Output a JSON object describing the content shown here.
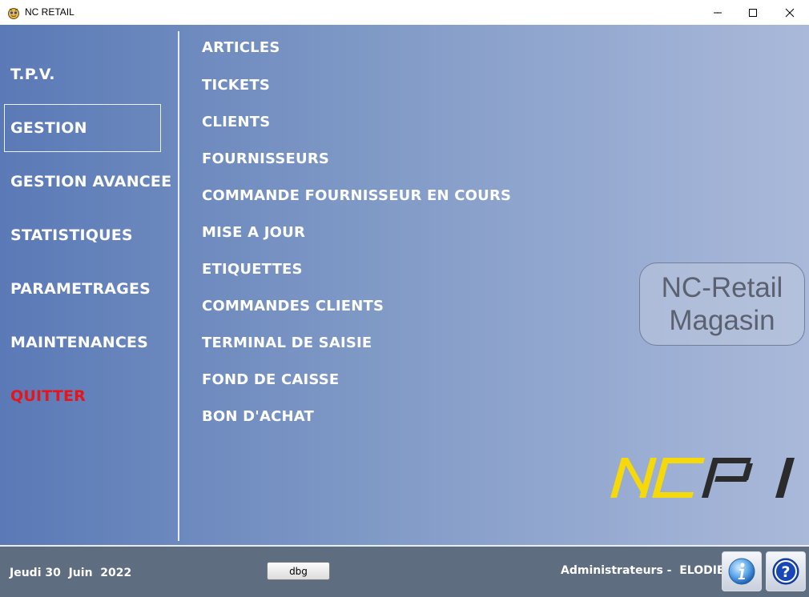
{
  "window": {
    "title": "NC RETAIL"
  },
  "sidebar": {
    "items": [
      {
        "label": "T.P.V."
      },
      {
        "label": "GESTION"
      },
      {
        "label": "GESTION AVANCEE"
      },
      {
        "label": "STATISTIQUES"
      },
      {
        "label": "PARAMETRAGES"
      },
      {
        "label": "MAINTENANCES"
      },
      {
        "label": "QUITTER"
      }
    ],
    "selected": "GESTION",
    "quit_color": "#e8141a"
  },
  "menu": {
    "items": [
      {
        "label": "ARTICLES"
      },
      {
        "label": "TICKETS"
      },
      {
        "label": "CLIENTS"
      },
      {
        "label": "FOURNISSEURS"
      },
      {
        "label": "COMMANDE FOURNISSEUR EN COURS"
      },
      {
        "label": "MISE A JOUR"
      },
      {
        "label": "ETIQUETTES"
      },
      {
        "label": "COMMANDES CLIENTS"
      },
      {
        "label": "TERMINAL DE SAISIE"
      },
      {
        "label": "FOND DE CAISSE"
      },
      {
        "label": "BON D'ACHAT"
      }
    ]
  },
  "brand": {
    "line1": "NC-Retail",
    "line2": "Magasin",
    "logo_text": "NCPI",
    "logo_colors": {
      "yellow": "#f5d90a",
      "dark": "#2b2b2b"
    }
  },
  "footer": {
    "date": "Jeudi 30  Juin  2022",
    "dbg_label": "dbg",
    "user": "Administrateurs -  ELODIE"
  },
  "icons": {
    "app": "nc-retail-app-icon",
    "info": "info-icon",
    "help": "help-icon"
  }
}
